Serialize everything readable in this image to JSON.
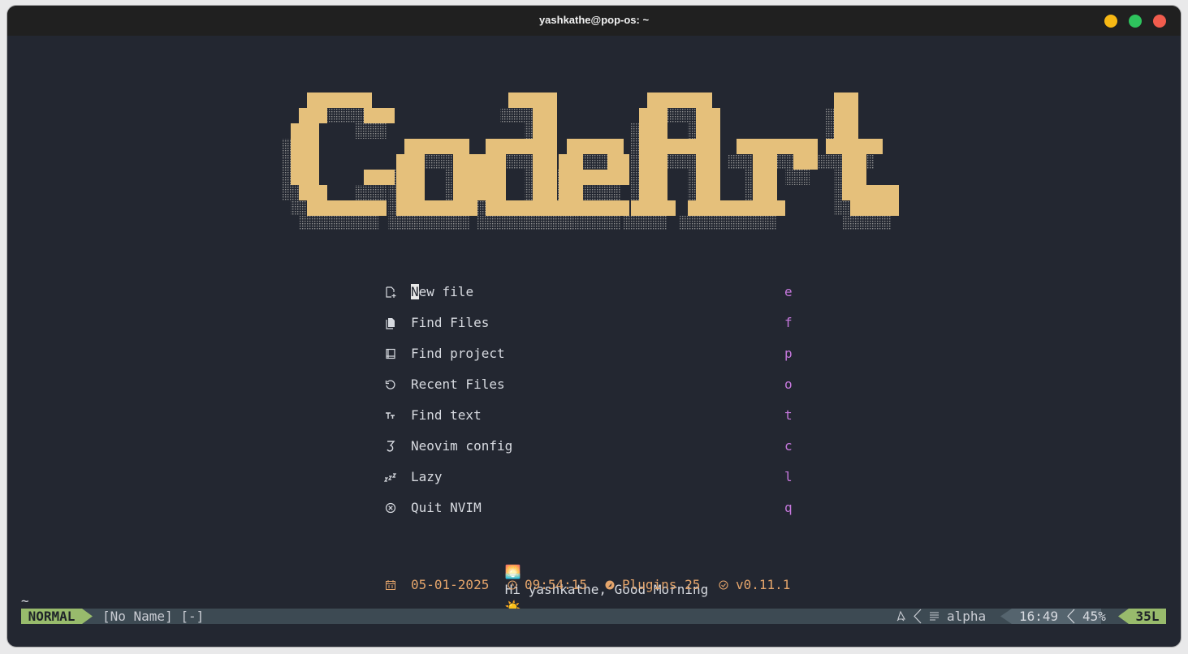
{
  "window": {
    "title": "yashkathe@pop-os: ~"
  },
  "colors": {
    "background": "#232731",
    "logo": "#e5c07b",
    "key": "#c678dd",
    "info": "#e5a56b",
    "statusline_bg": "#3d4a53",
    "mode_bg": "#98bb6c",
    "minimize": "#f7b814",
    "maximize": "#2ec35d",
    "close": "#f15c4d"
  },
  "logo": {
    "text": "CodeArt"
  },
  "menu": [
    {
      "icon": "new-file-icon",
      "label": "New file",
      "key": "e"
    },
    {
      "icon": "find-files-icon",
      "label": "Find Files",
      "key": "f"
    },
    {
      "icon": "project-icon",
      "label": "Find project",
      "key": "p"
    },
    {
      "icon": "history-icon",
      "label": "Recent Files",
      "key": "o"
    },
    {
      "icon": "text-icon",
      "label": "Find text",
      "key": "t"
    },
    {
      "icon": "neovim-icon",
      "label": "Neovim config",
      "key": "c"
    },
    {
      "icon": "sleep-icon",
      "label": "Lazy",
      "key": "l"
    },
    {
      "icon": "quit-icon",
      "label": "Quit NVIM",
      "key": "q"
    }
  ],
  "greeting": {
    "emoji": "🌅",
    "text": "Hi yashkathe, Good Morning",
    "sun": "☀️"
  },
  "info": {
    "date": "05-01-2025",
    "time": "09:54:15",
    "plugins": "Plugins 25",
    "version": "v0.11.1"
  },
  "buffer": {
    "tilde": "~"
  },
  "statusline": {
    "mode": "NORMAL",
    "filename": "[No Name] [-]",
    "filetype": "alpha",
    "clock": "16:49",
    "percent": "45%",
    "lines": "35L"
  }
}
